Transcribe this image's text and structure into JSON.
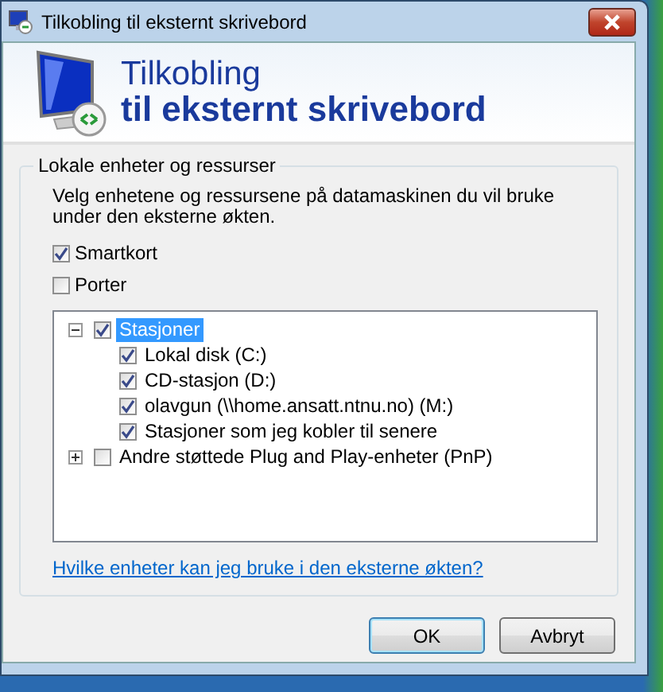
{
  "window": {
    "title": "Tilkobling til eksternt skrivebord"
  },
  "header": {
    "line_1": "Tilkobling",
    "line_2": "til eksternt skrivebord"
  },
  "group": {
    "title": "Lokale enheter og ressurser",
    "description": "Velg enhetene og ressursene på datamaskinen du vil bruke under den eksterne økten.",
    "options": [
      {
        "label": "Smartkort",
        "checked": true
      },
      {
        "label": "Porter",
        "checked": false
      }
    ],
    "tree": [
      {
        "label": "Stasjoner",
        "checked": true,
        "expanded": true,
        "selected": true,
        "children": [
          {
            "label": "Lokal disk (C:)",
            "checked": true,
            "selected": false
          },
          {
            "label": "CD-stasjon (D:)",
            "checked": true,
            "selected": false
          },
          {
            "label": "olavgun (\\\\home.ansatt.ntnu.no) (M:)",
            "checked": true,
            "selected": false
          },
          {
            "label": "Stasjoner som jeg kobler til senere",
            "checked": true,
            "selected": false
          }
        ]
      },
      {
        "label": "Andre støttede Plug and Play-enheter (PnP)",
        "checked": false,
        "expanded": false,
        "selected": false
      }
    ],
    "link": "Hvilke enheter kan jeg bruke i den eksterne økten?"
  },
  "buttons": [
    {
      "label": "OK",
      "default": true
    },
    {
      "label": "Avbryt",
      "default": false
    }
  ]
}
